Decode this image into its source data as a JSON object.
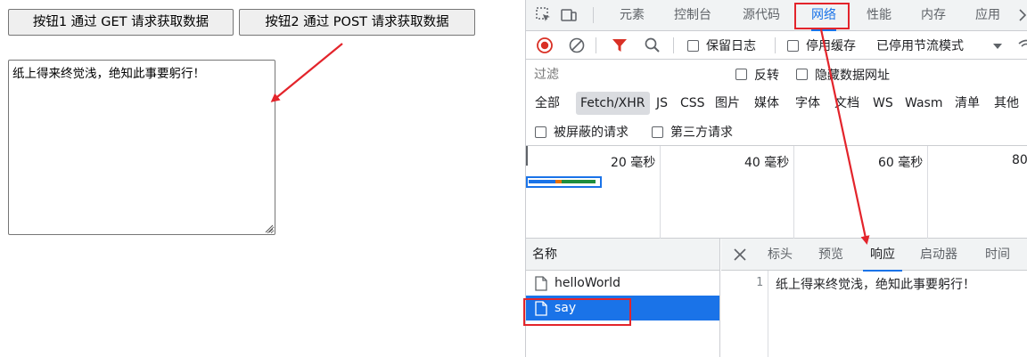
{
  "page": {
    "button1_label": "按钮1 通过 GET 请求获取数据",
    "button2_label": "按钮2 通过 POST 请求获取数据",
    "result_text": "纸上得来终觉浅，绝知此事要躬行！"
  },
  "devtools": {
    "tabs": [
      {
        "label": "元素"
      },
      {
        "label": "控制台"
      },
      {
        "label": "源代码"
      },
      {
        "label": "网络",
        "active": true
      },
      {
        "label": "性能"
      },
      {
        "label": "内存"
      },
      {
        "label": "应用"
      }
    ],
    "more_tabs_icon": "chevron-right-icon",
    "toolbar": {
      "preserve_log": "保留日志",
      "disable_cache": "停用缓存",
      "throttling": "已停用节流模式"
    },
    "filter": {
      "placeholder": "过滤",
      "invert": "反转",
      "hide_data_urls": "隐藏数据网址"
    },
    "type_filters": [
      "全部",
      "Fetch/XHR",
      "JS",
      "CSS",
      "图片",
      "媒体",
      "字体",
      "文档",
      "WS",
      "Wasm",
      "清单",
      "其他"
    ],
    "selected_type": "Fetch/XHR",
    "blocked_requests": "被屏蔽的请求",
    "third_party_requests": "第三方请求",
    "timeline_ticks": [
      "20 毫秒",
      "40 毫秒",
      "60 毫秒",
      "80"
    ],
    "names_header": "名称",
    "requests": [
      {
        "name": "helloWorld",
        "selected": false
      },
      {
        "name": "say",
        "selected": true
      }
    ],
    "detail_tabs": [
      {
        "label": "标头"
      },
      {
        "label": "预览"
      },
      {
        "label": "响应",
        "active": true
      },
      {
        "label": "启动器"
      },
      {
        "label": "时间"
      }
    ],
    "response": {
      "line_number": "1",
      "text": "纸上得来终觉浅，绝知此事要躬行！"
    }
  },
  "colors": {
    "accent": "#1a73e8",
    "record_stop": "#d93025",
    "annotation": "#e3242b",
    "waterfall_orange": "#e8710a",
    "waterfall_green": "#1e8e3e"
  }
}
